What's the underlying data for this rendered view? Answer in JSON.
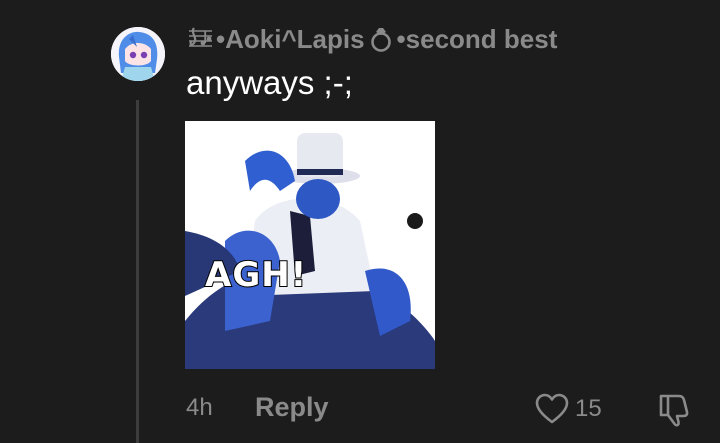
{
  "comment": {
    "author_prefix": "•",
    "author_name": "Aoki^Lapis",
    "author_suffix": "•second best",
    "text": "anyways ;-;",
    "attachment_caption": "AGH!",
    "timestamp": "4h",
    "reply_label": "Reply",
    "like_count": "15"
  },
  "icons": {
    "music_sheet": "music-notes-icon",
    "ring": "ring-icon",
    "heart": "heart-icon",
    "dislike": "thumbs-down-icon"
  },
  "colors": {
    "background": "#1c1c1c",
    "muted_text": "#8a8a8a",
    "primary_text": "#ffffff",
    "thread_line": "#3d3d3d"
  }
}
